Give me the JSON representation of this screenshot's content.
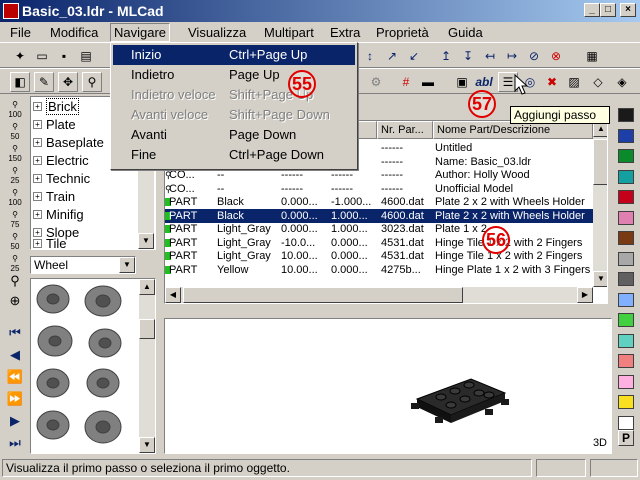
{
  "window": {
    "title": "Basic_03.ldr - MLCad",
    "minimize": "_",
    "maximize": "□",
    "close": "×"
  },
  "menubar": [
    "File",
    "Modifica",
    "Navigare",
    "Visualizza",
    "Multipart",
    "Extra",
    "Proprietà",
    "Guida"
  ],
  "dropdown": {
    "items": [
      {
        "label": "Inizio",
        "shortcut": "Ctrl+Page Up",
        "state": "highlighted"
      },
      {
        "label": "Indietro",
        "shortcut": "Page Up",
        "state": "enabled"
      },
      {
        "label": "Indietro veloce",
        "shortcut": "Shift+Page Up",
        "state": "disabled"
      },
      {
        "label": "Avanti veloce",
        "shortcut": "Shift+Page Down",
        "state": "disabled"
      },
      {
        "label": "Avanti",
        "shortcut": "Page Down",
        "state": "enabled"
      },
      {
        "label": "Fine",
        "shortcut": "Ctrl+Page Down",
        "state": "enabled"
      }
    ]
  },
  "toolbar_text": {
    "abl": "abl"
  },
  "tooltip": "Aggiungi passo",
  "annotations": {
    "a55": "55",
    "a56": "56",
    "a57": "57"
  },
  "zoom_levels": [
    "100",
    "50",
    "150",
    "25",
    "100",
    "75",
    "50",
    "25"
  ],
  "parts_tree": [
    "Brick",
    "Plate",
    "Baseplate",
    "Electric",
    "Technic",
    "Train",
    "Minifig",
    "Slope",
    "Tile"
  ],
  "category_select": "Wheel",
  "grid": {
    "headers": [
      "Nr. Par...",
      "Nome Part/Descrizione"
    ],
    "rows": [
      {
        "type": "",
        "color": "",
        "pos": "------",
        "mat": "",
        "nr": "------",
        "desc": "Untitled"
      },
      {
        "type": "",
        "color": "",
        "pos": "------",
        "mat": "",
        "nr": "------",
        "desc": "Name: Basic_03.ldr"
      },
      {
        "type": "CO...",
        "color": "--",
        "pos": "------",
        "mat": "------",
        "nr": "------",
        "desc": "Author: Holly Wood"
      },
      {
        "type": "CO...",
        "color": "--",
        "pos": "------",
        "mat": "------",
        "nr": "------",
        "desc": "Unofficial Model"
      },
      {
        "type": "PART",
        "color": "Black",
        "pos": "0.000...",
        "mat": "-1.000...",
        "nr": "4600.dat",
        "desc": "Plate  2 x  2 with Wheels Holder"
      },
      {
        "type": "PART",
        "color": "Black",
        "pos": "0.000...",
        "mat": "1.000...",
        "nr": "4600.dat",
        "desc": "Plate  2 x  2 with Wheels Holder"
      },
      {
        "type": "PART",
        "color": "Light_Gray",
        "pos": "0.000...",
        "mat": "1.000...",
        "nr": "3023.dat",
        "desc": "Plate  1 x  2"
      },
      {
        "type": "PART",
        "color": "Light_Gray",
        "pos": "-10.0...",
        "mat": "0.000...",
        "nr": "4531.dat",
        "desc": "Hinge Tile  1 x  2 with 2 Fingers"
      },
      {
        "type": "PART",
        "color": "Light_Gray",
        "pos": "10.00...",
        "mat": "0.000...",
        "nr": "4531.dat",
        "desc": "Hinge Tile  1 x  2 with 2 Fingers"
      },
      {
        "type": "PART",
        "color": "Yellow",
        "pos": "10.00...",
        "mat": "0.000...",
        "nr": "4275b...",
        "desc": "Hinge Plate  1 x  2 with 3 Fingers"
      }
    ],
    "selected_index": 5
  },
  "view_label": "3D",
  "palette": {
    "colors": [
      "#1a1a1a",
      "#1e3ea8",
      "#0a8a2a",
      "#14a0a0",
      "#c4001a",
      "#e080b0",
      "#7a3a14",
      "#a8a8a8",
      "#606060",
      "#80b0ff",
      "#40d040",
      "#60d0c0",
      "#f08080",
      "#ffb0e0",
      "#f8e020",
      "#ffffff"
    ],
    "label": "P"
  },
  "statusbar": {
    "text": "Visualizza il primo passo o seleziona il primo oggetto."
  }
}
